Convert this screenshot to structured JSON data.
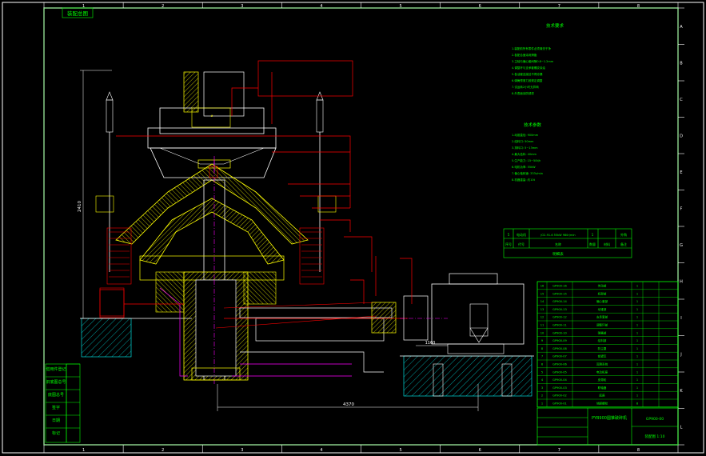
{
  "drawing": {
    "corner_stamp": "装配总图",
    "grid_top": [
      "1",
      "2",
      "3",
      "4",
      "5",
      "6",
      "7",
      "8"
    ],
    "grid_bottom": [
      "1",
      "2",
      "3",
      "4",
      "5",
      "6",
      "7",
      "8"
    ],
    "grid_right": [
      "A",
      "B",
      "C",
      "D",
      "E",
      "F",
      "G",
      "H",
      "I",
      "J",
      "K",
      "L"
    ],
    "notes_title": "技术要求",
    "notes_lines": [
      "1.装配前所有零件必须清洗干净",
      "2.各配合面涂润滑脂",
      "3.主轴与偏心套间隙0.8~1.2mm",
      "4.调整环与支承套螺纹涂油",
      "5.各油管连接处不得渗漏",
      "6.弹簧预紧力按规定调整",
      "7.试运转2小时无异响",
      "8.外表面涂防锈漆"
    ],
    "params_title": "技术参数",
    "params_lines": [
      "1.动锥直径: 900mm",
      "2.给料口: 50mm",
      "3.排料口: 5~13mm",
      "4.最大给料: 40mm",
      "5.生产能力: 15~50t/h",
      "6.电机功率: 55kW",
      "7.偏心轴转速: 333r/min",
      "8.机器重量: 约10t"
    ],
    "mid_table_row1": [
      "5",
      "电动机",
      "JO2-91-6 55kW 980r/min",
      "1",
      "",
      "外购"
    ],
    "mid_table_row2": [
      "序号",
      "代号",
      "名称",
      "数量",
      "材料",
      "备注"
    ],
    "mid_table_caption": "明细表",
    "dimension_height": "2410",
    "dimension_width": "4370",
    "dimension_motor": "1160",
    "bom_rows": [
      [
        "16",
        "GP900-16",
        "传动部",
        "1",
        "",
        ""
      ],
      [
        "15",
        "GP900-15",
        "机架部",
        "1",
        "",
        ""
      ],
      [
        "14",
        "GP900-14",
        "偏心套部",
        "1",
        "",
        ""
      ],
      [
        "13",
        "GP900-13",
        "动锥部",
        "1",
        "",
        ""
      ],
      [
        "12",
        "GP900-12",
        "支承套部",
        "1",
        "",
        ""
      ],
      [
        "11",
        "GP900-11",
        "调整环部",
        "1",
        "",
        ""
      ],
      [
        "10",
        "GP900-10",
        "弹簧部",
        "1",
        "",
        ""
      ],
      [
        "9",
        "GP900-09",
        "给料部",
        "1",
        "",
        ""
      ],
      [
        "8",
        "GP900-08",
        "防尘罩",
        "1",
        "",
        ""
      ],
      [
        "7",
        "GP900-07",
        "锁紧缸",
        "1",
        "",
        ""
      ],
      [
        "6",
        "GP900-06",
        "润滑系统",
        "1",
        "",
        ""
      ],
      [
        "5",
        "GP900-05",
        "电动机座",
        "1",
        "",
        ""
      ],
      [
        "4",
        "GP900-04",
        "皮带轮",
        "1",
        "",
        ""
      ],
      [
        "3",
        "GP900-03",
        "联轴器",
        "1",
        "",
        ""
      ],
      [
        "2",
        "GP900-02",
        "底座",
        "1",
        "",
        ""
      ],
      [
        "1",
        "GP900-01",
        "地脚螺栓",
        "8",
        "",
        ""
      ]
    ],
    "title_block_name": "PYB900圆锥破碎机",
    "title_block_code1": "GP900-00",
    "title_block_code2": "装配图 1:10",
    "left_strip": [
      "借用件登记",
      "旧底图总号",
      "底图总号",
      "签字",
      "日期",
      "标记"
    ],
    "colors": {
      "frame": "#ffffff",
      "outline": "#ffff00",
      "leaders": "#ff0000",
      "text": "#00ff00",
      "hatch": "#00ffff",
      "center": "#ff00ff",
      "white": "#ffffff"
    }
  }
}
